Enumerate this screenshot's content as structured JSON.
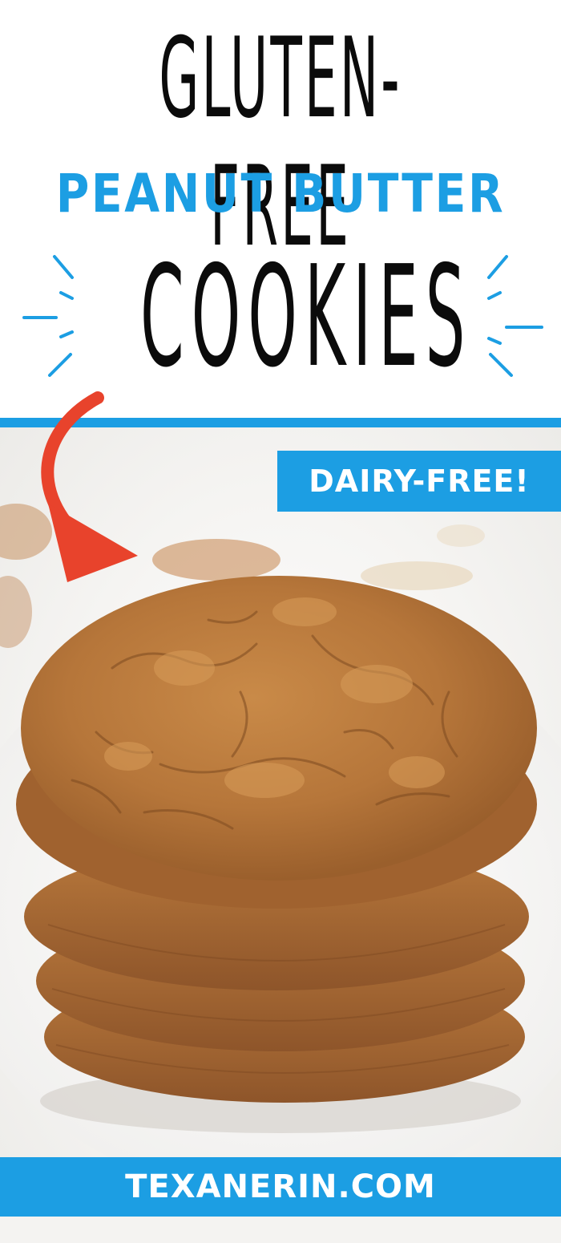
{
  "header": {
    "line1": "GLUTEN-FREE",
    "line2": "PEANUT BUTTER",
    "line3": "COOKIES"
  },
  "badge": {
    "label": "DAIRY-FREE!"
  },
  "footer": {
    "site": "TEXANERIN.COM"
  },
  "colors": {
    "accent_blue": "#1c9ee3",
    "arrow_red": "#e8432c",
    "title_black": "#0b0b0b",
    "cookie_brown": "#b9773a"
  },
  "icons": {
    "burst": "sparkle-burst-icon",
    "arrow": "curved-arrow-icon"
  },
  "photo": {
    "subject": "cookie-stack-photo",
    "cookie_count": 4
  }
}
